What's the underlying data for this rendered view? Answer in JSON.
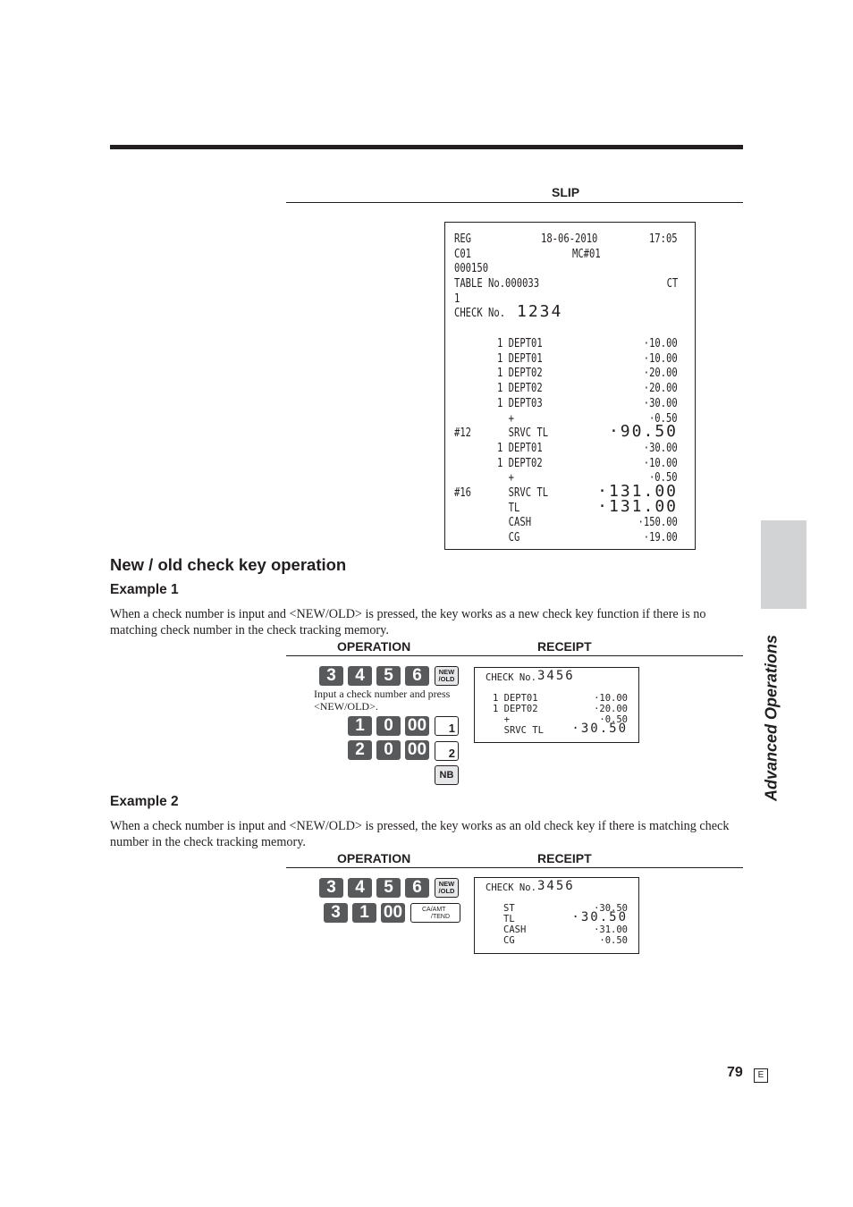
{
  "page": {
    "section_tab_label": "Advanced Operations",
    "page_number": "79",
    "language_badge": "E"
  },
  "slip": {
    "header": "SLIP",
    "lines": [
      {
        "left": "REG",
        "mid": "18-06-2010",
        "right": "17:05"
      },
      {
        "left": "C01",
        "mid": "MC#01",
        "right": ""
      },
      {
        "left": "000150",
        "mid": "",
        "right": ""
      },
      {
        "left": "TABLE No.000033",
        "mid": "",
        "right": "CT"
      },
      {
        "left": "1",
        "mid": "",
        "right": ""
      },
      {
        "left": "CHECK No.",
        "big": "1234"
      }
    ],
    "items": [
      {
        "num": "",
        "desc": "1 DEPT01",
        "amount": "·10.00",
        "big": false
      },
      {
        "num": "",
        "desc": "1 DEPT01",
        "amount": "·10.00",
        "big": false
      },
      {
        "num": "",
        "desc": "1 DEPT02",
        "amount": "·20.00",
        "big": false
      },
      {
        "num": "",
        "desc": "1 DEPT02",
        "amount": "·20.00",
        "big": false
      },
      {
        "num": "",
        "desc": "1 DEPT03",
        "amount": "·30.00",
        "big": false
      },
      {
        "num": "",
        "desc": "  +",
        "amount": "·0.50",
        "big": false
      },
      {
        "num": "#12",
        "desc": "  SRVC TL",
        "amount": "·90.50",
        "big": true
      },
      {
        "num": "",
        "desc": "1 DEPT01",
        "amount": "·30.00",
        "big": false
      },
      {
        "num": "",
        "desc": "1 DEPT02",
        "amount": "·10.00",
        "big": false
      },
      {
        "num": "",
        "desc": "  +",
        "amount": "·0.50",
        "big": false
      },
      {
        "num": "#16",
        "desc": "  SRVC TL",
        "amount": "·131.00",
        "big": true
      },
      {
        "num": "",
        "desc": "  TL",
        "amount": "·131.00",
        "big": true
      },
      {
        "num": "",
        "desc": "  CASH",
        "amount": "·150.00",
        "big": false
      },
      {
        "num": "",
        "desc": "  CG",
        "amount": "·19.00",
        "big": false
      }
    ]
  },
  "section": {
    "title": "New / old check key operation"
  },
  "example1": {
    "title": "Example 1",
    "text": "When a check number is input and <NEW/OLD> is pressed, the key works as a new check key function if there is no matching check number in the check tracking memory.",
    "operation_header": "OPERATION",
    "receipt_header": "RECEIPT",
    "keys_row1": [
      "3",
      "4",
      "5",
      "6"
    ],
    "new_old_key": "NEW\n/OLD",
    "new_old_top": "NEW",
    "new_old_bottom": "/OLD",
    "note": "Input a check number and press <NEW/OLD>.",
    "keys_row2": [
      "1",
      "0",
      "00"
    ],
    "dept_key_1": "1",
    "keys_row3": [
      "2",
      "0",
      "00"
    ],
    "dept_key_2": "2",
    "nb_key": "NB",
    "receipt": {
      "check_label": "CHECK No.",
      "check_number": "3456",
      "lines": [
        {
          "desc": "1 DEPT01",
          "amount": "·10.00",
          "big": false
        },
        {
          "desc": "1 DEPT02",
          "amount": "·20.00",
          "big": false
        },
        {
          "desc": "  +",
          "amount": "·0.50",
          "big": false
        },
        {
          "desc": "  SRVC TL",
          "amount": "·30.50",
          "big": true
        }
      ]
    }
  },
  "example2": {
    "title": "Example 2",
    "text": "When a check number is input and <NEW/OLD> is pressed, the key works as an old check key if there is matching check number in the check tracking memory.",
    "operation_header": "OPERATION",
    "receipt_header": "RECEIPT",
    "keys_row1": [
      "3",
      "4",
      "5",
      "6"
    ],
    "new_old_top": "NEW",
    "new_old_bottom": "/OLD",
    "keys_row2": [
      "3",
      "1",
      "00"
    ],
    "tend_key_top": "CA/AMT",
    "tend_key_bottom": "/TEND",
    "receipt": {
      "check_label": "CHECK No.",
      "check_number": "3456",
      "lines": [
        {
          "desc": "ST",
          "amount": "·30.50",
          "big": false
        },
        {
          "desc": "TL",
          "amount": "·30.50",
          "big": true
        },
        {
          "desc": "CASH",
          "amount": "·31.00",
          "big": false
        },
        {
          "desc": "CG",
          "amount": "·0.50",
          "big": false
        }
      ]
    }
  }
}
